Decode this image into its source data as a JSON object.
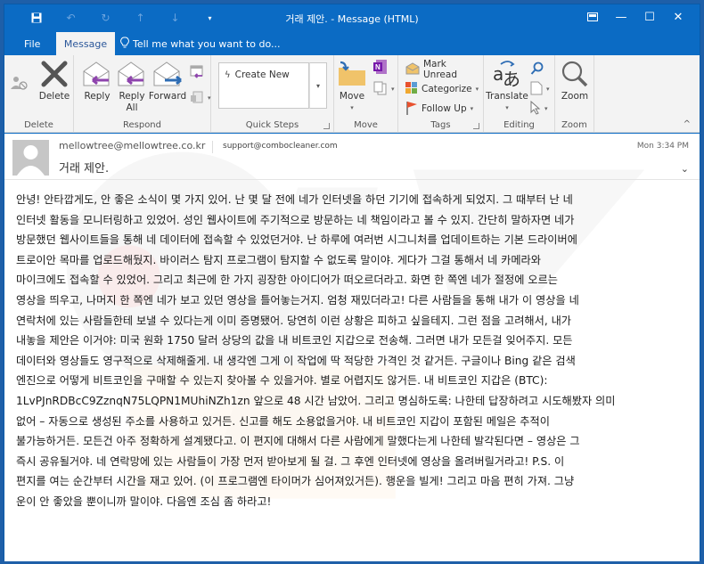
{
  "window": {
    "title": "거래 제안. - Message (HTML)",
    "controls": {
      "restore_ribbon_icon": "ribbon-display-icon",
      "minimize": "—",
      "maximize": "☐",
      "close": "✕"
    }
  },
  "quick_access": {
    "save": "save-icon",
    "undo": "undo-icon",
    "redo": "redo-icon",
    "prev": "up-arrow-icon",
    "next": "down-arrow-icon",
    "customize": "customize-icon"
  },
  "tabs": [
    {
      "label": "File",
      "active": false
    },
    {
      "label": "Message",
      "active": true
    }
  ],
  "tell_me": "Tell me what you want to do...",
  "ribbon": {
    "groups": [
      {
        "label": "Delete",
        "buttons": [
          {
            "label": "Ignore"
          },
          {
            "label": "Delete"
          }
        ]
      },
      {
        "label": "Respond",
        "buttons": [
          {
            "label": "Reply"
          },
          {
            "label": "Reply All"
          },
          {
            "label": "Forward"
          },
          {
            "label": "Meeting"
          },
          {
            "label": "More"
          }
        ]
      },
      {
        "label": "Quick Steps",
        "buttons": [
          {
            "label": "Create New"
          }
        ]
      },
      {
        "label": "Move",
        "buttons": [
          {
            "label": "Move"
          },
          {
            "label": "OneNote"
          },
          {
            "label": "Actions"
          }
        ]
      },
      {
        "label": "Tags",
        "buttons": [
          {
            "label": "Mark Unread"
          },
          {
            "label": "Categorize"
          },
          {
            "label": "Follow Up"
          }
        ]
      },
      {
        "label": "Editing",
        "buttons": [
          {
            "label": "Translate"
          },
          {
            "label": "Find"
          },
          {
            "label": "Related"
          },
          {
            "label": "Select"
          }
        ]
      },
      {
        "label": "Zoom",
        "buttons": [
          {
            "label": "Zoom"
          }
        ]
      }
    ],
    "reply_all_line1": "Reply",
    "reply_all_line2": "All",
    "dropdown_glyph": "▾",
    "collapse_glyph": "^"
  },
  "message": {
    "from": "mellowtree@mellowtree.co.kr",
    "to": "support@combocleaner.com",
    "subject": "거래 제안.",
    "date": "Mon 3:34 PM",
    "expand_glyph": "⌄",
    "body_lines": [
      "안녕! 안타깝게도, 안 좋은 소식이 몇 가지 있어. 난 몇 달 전에 네가 인터넷을 하던 기기에 접속하게 되었지. 그 때부터 난 네",
      "인터넷 활동을 모니터링하고 있었어. 성인 웹사이트에 주기적으로 방문하는 네 책임이라고 볼 수 있지. 간단히 말하자면 네가",
      "방문했던 웹사이트들을 통해 네 데이터에 접속할 수 있었던거야. 난 하루에 여러번 시그니처를 업데이트하는 기본 드라이버에",
      "트로이안 목마를 업로드해뒀지. 바이러스 탐지 프로그램이 탐지할 수 없도록 말이야. 게다가 그걸 통해서 네 카메라와",
      "마이크에도 접속할 수 있었어. 그리고 최근에 한 가지 굉장한 아이디어가 떠오르더라고. 화면 한 쪽엔 네가 절정에 오르는",
      "영상을 띄우고, 나머지 한 쪽엔 네가 보고 있던 영상을 틀어놓는거지. 엄청 재밌더라고! 다른 사람들을 통해 내가 이 영상을 네",
      "연락처에 있는 사람들한테 보낼 수 있다는게 이미 증명됐어. 당연히 이런 상황은 피하고 싶을테지. 그런 점을 고려해서, 내가",
      "내놓을 제안은 이거야: 미국 원화 1750 달러 상당의 값을 내 비트코인 지갑으로 전송해. 그러면 내가 모든걸 잊어주지. 모든",
      "데이터와 영상들도 영구적으로 삭제해줄게. 내 생각엔 그게 이 작업에 딱 적당한 가격인 것 같거든. 구글이나 Bing 같은 검색",
      "엔진으로 어떻게 비트코인을 구매할 수 있는지 찾아볼 수 있을거야. 별로 어렵지도 않거든. 내 비트코인 지갑은 (BTC):",
      "1LvPJnRDBcC9ZznqN75LQPN1MUhiNZh1zn 앞으로 48 시간 남았어. 그리고 명심하도록: 나한테 답장하려고 시도해봤자 의미",
      "없어 – 자동으로 생성된 주소를 사용하고 있거든. 신고를 해도 소용없을거야. 내 비트코인 지갑이 포함된 메일은 추적이",
      "불가능하거든. 모든건 아주 정확하게 설계됐다고. 이 편지에 대해서 다른 사람에게 말했다는게 나한테 발각된다면 – 영상은 그",
      "즉시 공유될거야. 네 연락망에 있는 사람들이 가장 먼저 받아보게 될 걸. 그 후엔 인터넷에 영상을 올려버릴거라고! P.S. 이",
      "편지를 여는 순간부터 시간을 재고 있어. (이 프로그램엔 타이머가 심어져있거든). 행운을 빌게! 그리고 마음 편히 가져. 그냥",
      "운이 안 좋았을 뿐이니까 말이야. 다음엔 조심 좀 하라고!"
    ]
  },
  "colors": {
    "accent": "#0b6bc4",
    "ribbon_bg": "#f3f3f3",
    "reply_arrow": "#8e44ad",
    "forward_arrow": "#2e6db4",
    "folder": "#f0c36a",
    "flag": "#e8512e"
  }
}
